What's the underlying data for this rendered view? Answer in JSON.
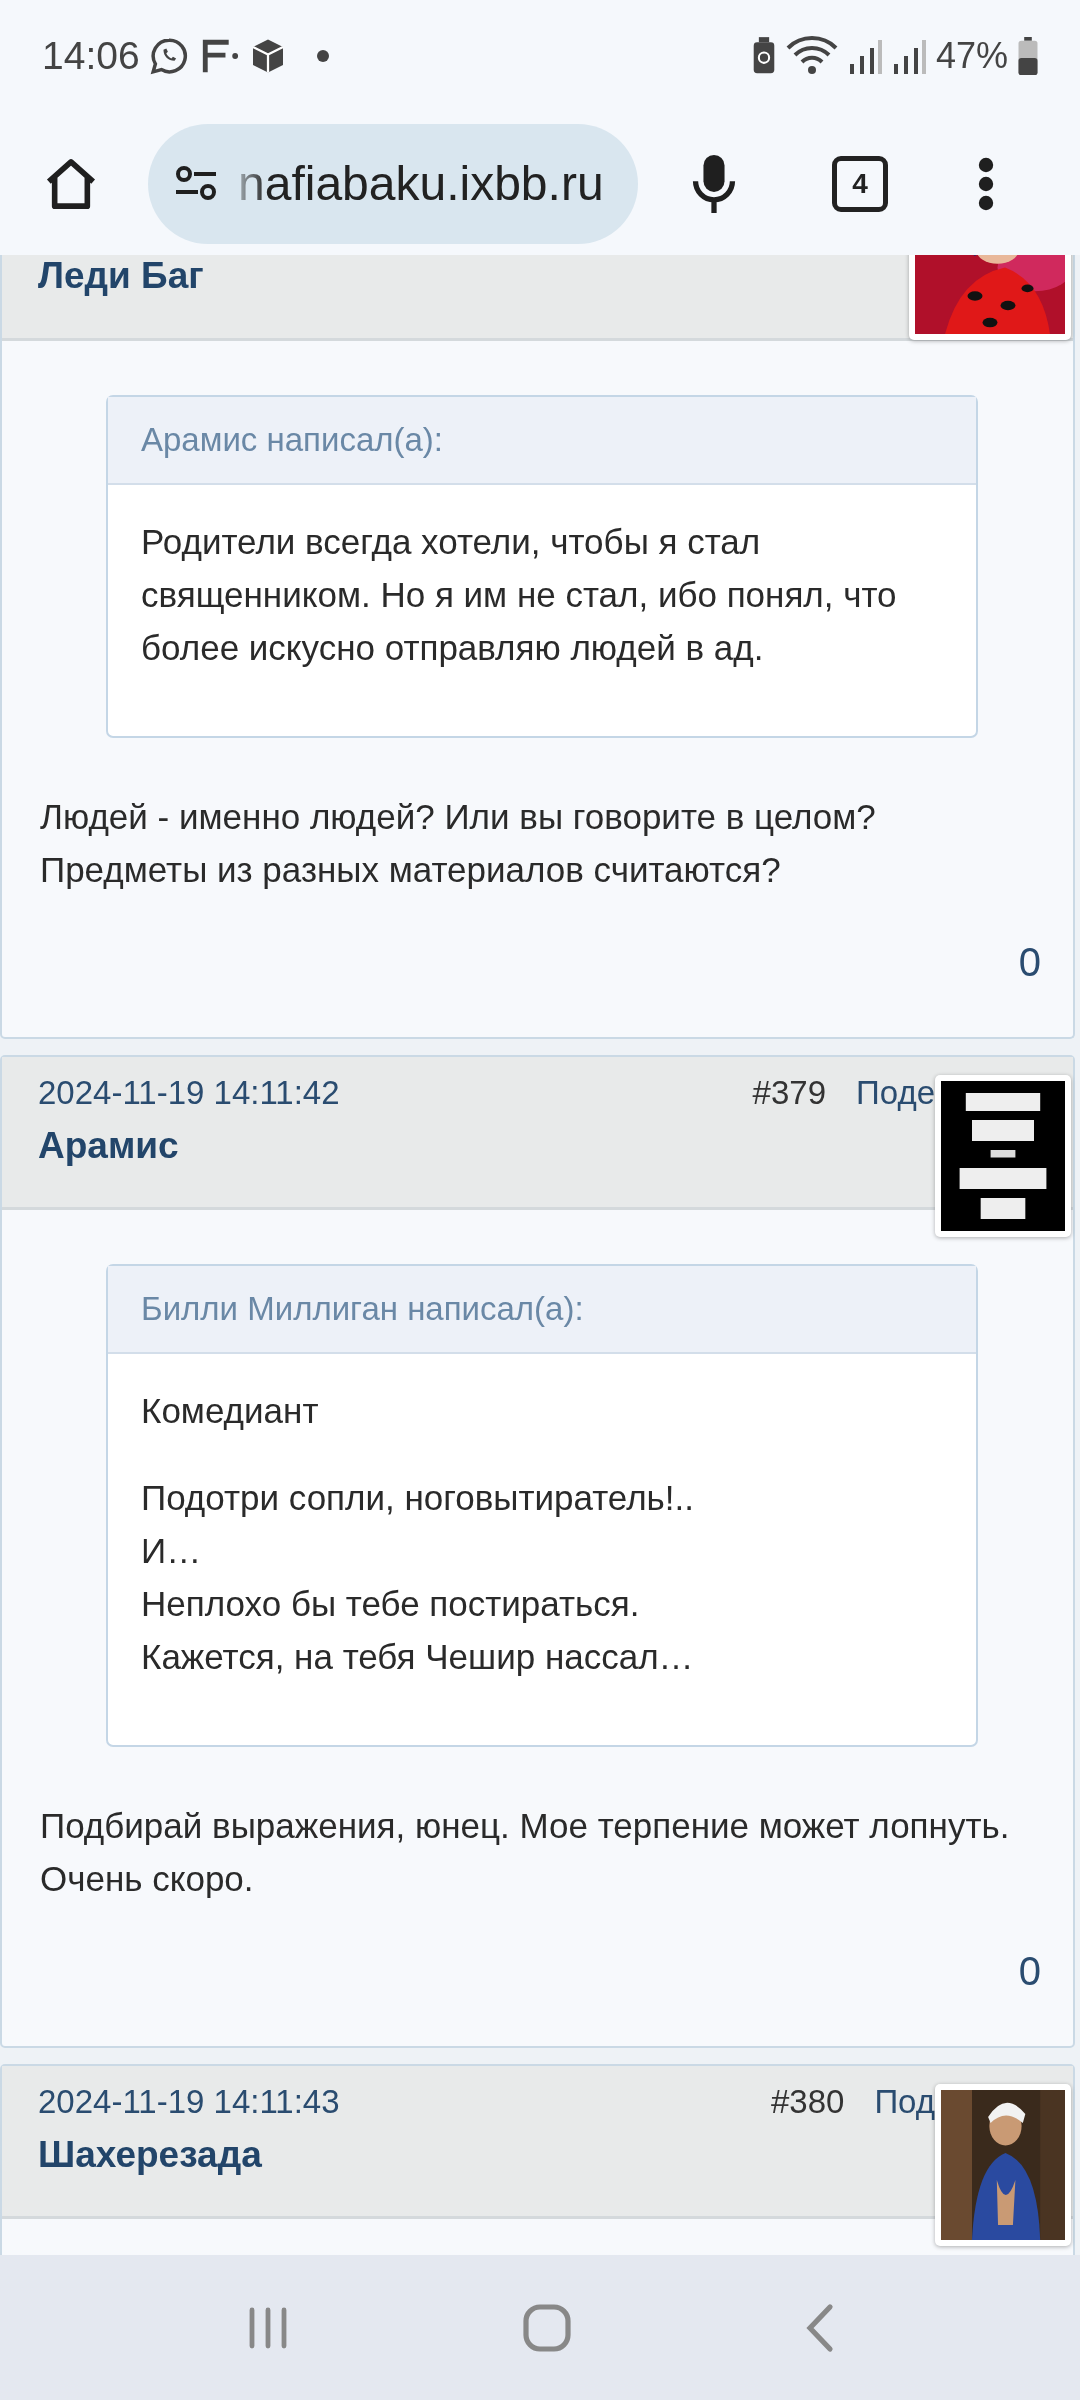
{
  "status_bar": {
    "time": "14:06",
    "battery": "47%"
  },
  "browser": {
    "url": "nafiabaku.ixbb.ru",
    "tab_count": "4"
  },
  "posts": [
    {
      "author": "Леди Баг",
      "avatar": {
        "kind": "picture"
      },
      "quote": {
        "header": "Арамис написал(а):",
        "paragraphs": [
          [
            "Родители всегда хотели, чтобы я стал",
            "священником. Но я им не стал, ибо  понял, что",
            "более искусно отправляю людей в ад."
          ]
        ]
      },
      "body": [
        "Людей - именно людей? Или вы говорите в целом?",
        "Предметы из разных материалов считаются?"
      ],
      "rating": "0"
    },
    {
      "date": "2024-11-19 14:11:42",
      "number": "#379",
      "action": "Поде",
      "author": "Арамис",
      "avatar": {
        "kind": "picture"
      },
      "quote": {
        "header": "Билли Миллиган написал(а):",
        "paragraphs": [
          [
            "Комедиант"
          ],
          [
            "Подотри сопли, ноговытиратель!..",
            "И…",
            "Неплохо бы тебе постираться.",
            "Кажется, на тебя Чешир нассал…"
          ]
        ]
      },
      "body": [
        "Подбирай выражения, юнец. Мое терпение может лопнуть.",
        "Очень скоро."
      ],
      "rating": "0"
    },
    {
      "date": "2024-11-19 14:11:43",
      "number": "#380",
      "action": "Под",
      "author": "Шахерезада",
      "avatar": {
        "kind": "picture"
      }
    }
  ]
}
